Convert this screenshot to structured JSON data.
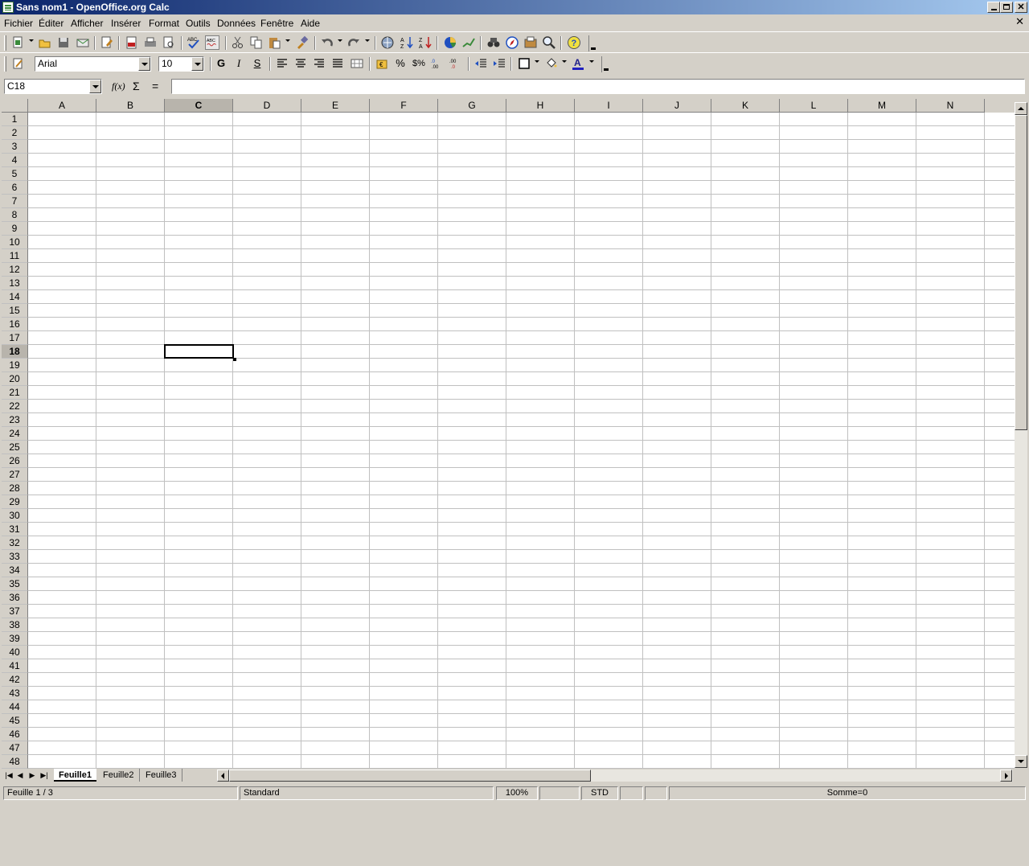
{
  "window": {
    "title": "Sans nom1 - OpenOffice.org Calc",
    "minimize": "0",
    "restore": "2",
    "close": "r"
  },
  "menu": [
    "Fichier",
    "Éditer",
    "Afficher",
    "Insérer",
    "Format",
    "Outils",
    "Données",
    "Fenêtre",
    "Aide"
  ],
  "doc_close": "✕",
  "toolbar_standard": {
    "icons": [
      "new-icon",
      "open-icon",
      "save-icon",
      "email-icon",
      "edit-file-icon",
      "export-pdf-icon",
      "print-icon",
      "page-preview-icon",
      "spellcheck-icon",
      "autospellcheck-icon",
      "cut-icon",
      "copy-icon",
      "paste-icon",
      "format-paintbrush-icon",
      "undo-icon",
      "redo-icon",
      "hyperlink-icon",
      "sort-ascending-icon",
      "sort-descending-icon",
      "chart-icon",
      "show-draw-functions-icon",
      "find-replace-icon",
      "navigator-icon",
      "gallery-icon",
      "zoom-icon",
      "help-icon"
    ]
  },
  "formatting": {
    "font_name": "Arial",
    "font_size": "10",
    "bold": "G",
    "italic": "I",
    "underline": "S",
    "percent": "%",
    "currency": "$%"
  },
  "formula_bar": {
    "name_box": "C18",
    "function_wizard": "f(x)",
    "sum": "Σ",
    "equals": "=",
    "formula": ""
  },
  "sheet": {
    "columns": [
      "A",
      "B",
      "C",
      "D",
      "E",
      "F",
      "G",
      "H",
      "I",
      "J",
      "K",
      "L",
      "M",
      "N"
    ],
    "active_column": "C",
    "row_count": 48,
    "active_row": 18,
    "active_cell": "C18"
  },
  "tabs": [
    "Feuille1",
    "Feuille2",
    "Feuille3"
  ],
  "active_tab": "Feuille1",
  "status": {
    "sheet": "Feuille 1 / 3",
    "page_style": "Standard",
    "zoom": "100%",
    "mode": "STD",
    "sum": "Somme=0"
  },
  "colors": {
    "title_gradient_start": "#0a246a",
    "title_gradient_end": "#a6caf0",
    "chrome": "#d4d0c8",
    "grid_line": "#c0c0c0"
  }
}
